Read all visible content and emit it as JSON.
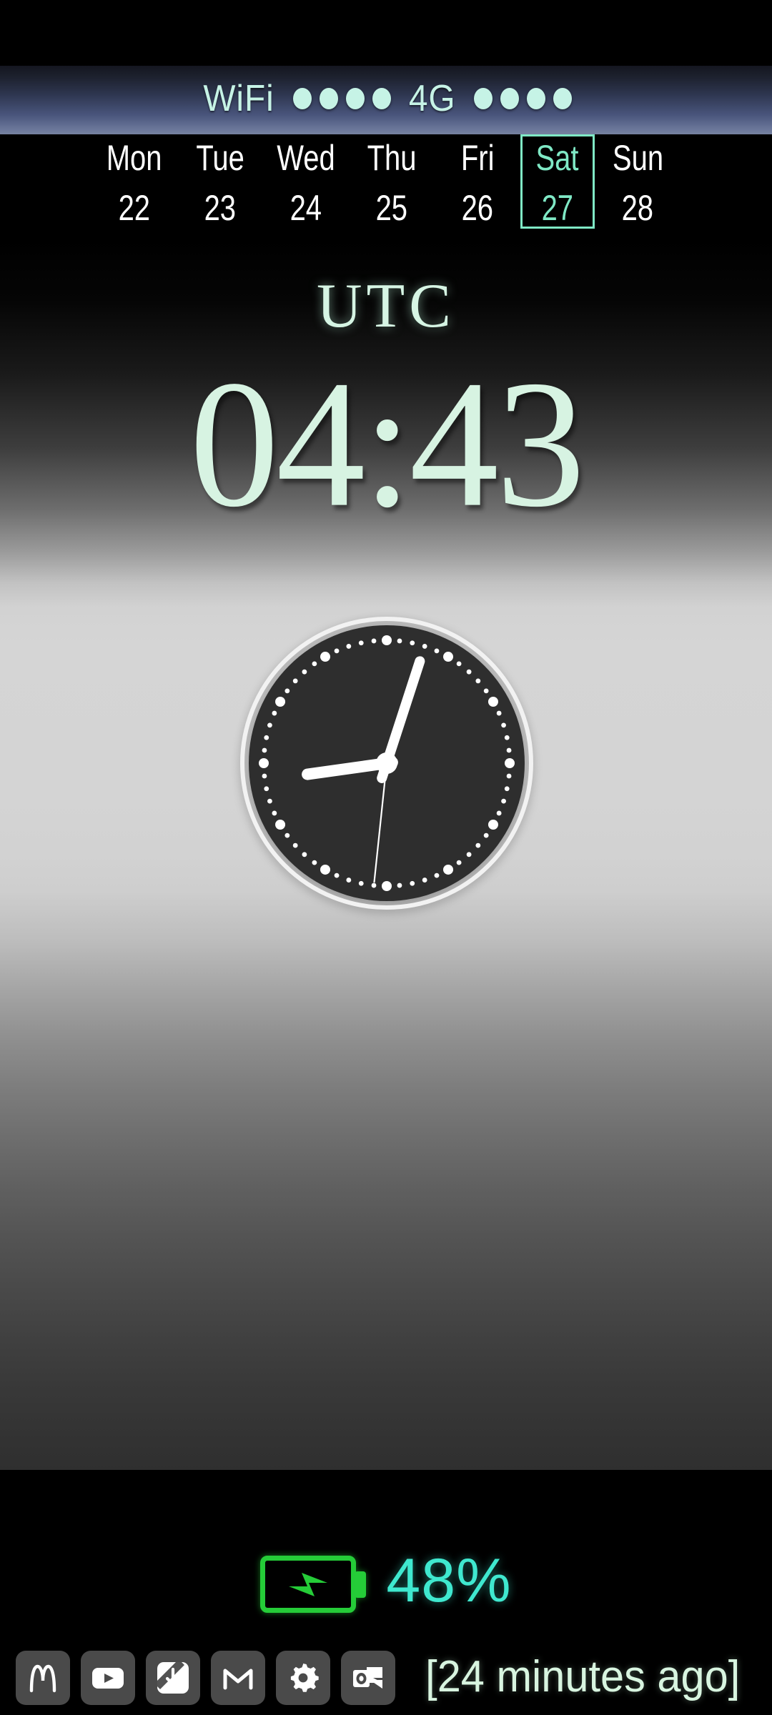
{
  "status_bar": {
    "wifi_label": "WiFi",
    "wifi_dots": 4,
    "network_label": "4G",
    "network_dots": 4,
    "accent_color": "#c6f3e6"
  },
  "week_strip": {
    "highlight_color": "#7fe8c5",
    "normal_color": "#ffffff",
    "days": [
      {
        "dow": "Mon",
        "date": "22",
        "today": false
      },
      {
        "dow": "Tue",
        "date": "23",
        "today": false
      },
      {
        "dow": "Wed",
        "date": "24",
        "today": false
      },
      {
        "dow": "Thu",
        "date": "25",
        "today": false
      },
      {
        "dow": "Fri",
        "date": "26",
        "today": false
      },
      {
        "dow": "Sat",
        "date": "27",
        "today": true
      },
      {
        "dow": "Sun",
        "date": "28",
        "today": false
      }
    ]
  },
  "clock": {
    "timezone_label": "UTC",
    "digital_time": "04:43",
    "digital_color": "#d7f3e2",
    "analog": {
      "hour_angle_deg": 262,
      "minute_angle_deg": 18,
      "second_angle_deg": 186,
      "face_color": "#2e2e2e",
      "ring_color": "#f2f2f2",
      "hand_color": "#ffffff",
      "minute_dot_count": 60
    }
  },
  "battery": {
    "percent_label": "48%",
    "charging": true,
    "icon_color": "#25cc38",
    "text_color": "#3fe8cf"
  },
  "app_row": {
    "apps": [
      {
        "name": "mcdonalds-icon",
        "label": "McDonald's"
      },
      {
        "name": "youtube-icon",
        "label": "YouTube"
      },
      {
        "name": "download-icon",
        "label": "Download"
      },
      {
        "name": "gmail-icon",
        "label": "Gmail"
      },
      {
        "name": "settings-icon",
        "label": "Settings"
      },
      {
        "name": "outlook-icon",
        "label": "Outlook"
      }
    ],
    "last_update_label": "[24 minutes ago]",
    "last_update_color": "#d8f5e0",
    "tile_color": "#4a4a4a"
  }
}
